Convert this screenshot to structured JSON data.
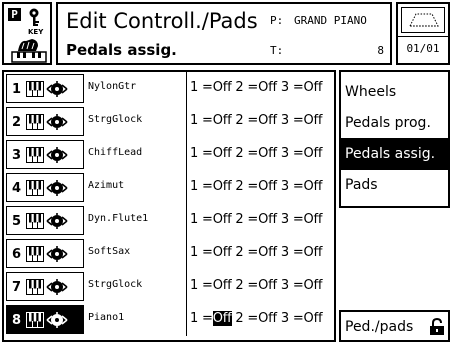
{
  "header": {
    "badge": "P",
    "title": "Edit Controll./Pads",
    "subtitle": "Pedals assig.",
    "p_label": "P:",
    "p_value": "GRAND PIANO",
    "t_label": "T:",
    "t_value": "8",
    "page_indicator": "01/01"
  },
  "tracks": [
    {
      "num": "1",
      "name": "NylonGtr",
      "assign": "1 =Off 2 =Off 3 =Off",
      "selected": false
    },
    {
      "num": "2",
      "name": "StrgGlock",
      "assign": "1 =Off 2 =Off 3 =Off",
      "selected": false
    },
    {
      "num": "3",
      "name": "ChiffLead",
      "assign": "1 =Off 2 =Off 3 =Off",
      "selected": false
    },
    {
      "num": "4",
      "name": "Azimut",
      "assign": "1 =Off 2 =Off 3 =Off",
      "selected": false
    },
    {
      "num": "5",
      "name": "Dyn.Flute1",
      "assign": "1 =Off 2 =Off 3 =Off",
      "selected": false
    },
    {
      "num": "6",
      "name": "SoftSax",
      "assign": "1 =Off 2 =Off 3 =Off",
      "selected": false
    },
    {
      "num": "7",
      "name": "StrgGlock",
      "assign": "1 =Off 2 =Off 3 =Off",
      "selected": false
    },
    {
      "num": "8",
      "name": "Piano1",
      "assign_prefix": "1 =",
      "assign_highlight": "Off",
      "assign_suffix": " 2 =Off 3 =Off",
      "selected": true
    }
  ],
  "menu": {
    "items": [
      {
        "label": "Wheels",
        "selected": false
      },
      {
        "label": "Pedals prog.",
        "selected": false
      },
      {
        "label": "Pedals assig.",
        "selected": true
      },
      {
        "label": "Pads",
        "selected": false
      }
    ],
    "ped_pads_button": "Ped./pads"
  },
  "icons": {
    "logo": "p-badge",
    "key": "key-icon",
    "hand": "hand-on-keys-icon",
    "disk": "disk-icon",
    "keyboard": "keyboard-icon",
    "figure": "dancer-icon",
    "lock": "lock-icon"
  }
}
